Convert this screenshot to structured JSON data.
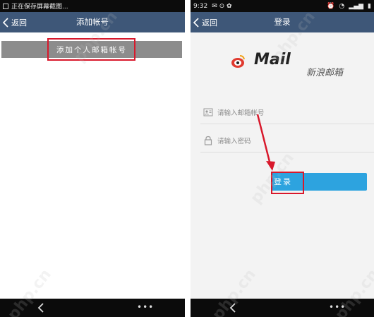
{
  "left": {
    "status_text": "正在保存屏幕截图...",
    "back_label": "返回",
    "title": "添加帐号",
    "add_button_label": "添加个人邮箱帐号"
  },
  "right": {
    "status_time": "9:32",
    "back_label": "返回",
    "title": "登录",
    "logo_mail": "Mail",
    "brand": "新浪邮箱",
    "email_placeholder": "请输入邮箱帐号",
    "password_placeholder": "请输入密码",
    "login_button_label": "登录"
  },
  "navbar": {
    "more_label": "•••"
  },
  "watermark": "php.cn",
  "colors": {
    "titlebar": "#3e5778",
    "login_button": "#2da3df",
    "highlight": "#d8182b",
    "add_button": "#8c8c8c"
  },
  "icons": [
    "back-chevron-icon",
    "user-card-icon",
    "lock-icon",
    "navbar-back-icon",
    "sina-eye-logo-icon"
  ]
}
